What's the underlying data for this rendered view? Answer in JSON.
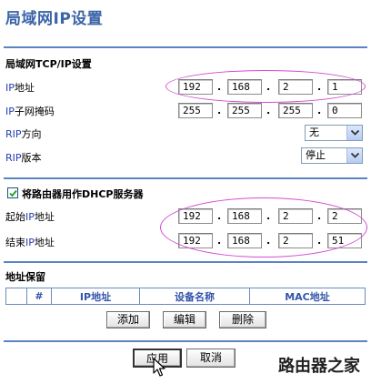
{
  "page": {
    "title": "局域网IP设置"
  },
  "lan_section": {
    "heading": "局域网TCP/IP设置",
    "ip_label_prefix": "IP",
    "ip_label_suffix": "地址",
    "ip": [
      "192",
      "168",
      "2",
      "1"
    ],
    "mask_label_prefix": "IP",
    "mask_label_suffix": "子网掩码",
    "mask": [
      "255",
      "255",
      "255",
      "0"
    ],
    "rip_dir_label_prefix": "RIP",
    "rip_dir_label_suffix": "方向",
    "rip_dir_value": "无",
    "rip_ver_label_prefix": "RIP",
    "rip_ver_label_suffix": "版本",
    "rip_ver_value": "停止"
  },
  "dhcp_section": {
    "checkbox_label": "将路由器用作DHCP服务器",
    "checked": true,
    "start_label_prefix": "起始",
    "start_label_mid": "IP",
    "start_label_suffix": "地址",
    "start_ip": [
      "192",
      "168",
      "2",
      "2"
    ],
    "end_label_prefix": "结束",
    "end_label_mid": "IP",
    "end_label_suffix": "地址",
    "end_ip": [
      "192",
      "168",
      "2",
      "51"
    ]
  },
  "reserve_section": {
    "heading": "地址保留",
    "columns": [
      "#",
      "IP地址",
      "设备名称",
      "MAC地址"
    ],
    "add_label": "添加",
    "edit_label": "编辑",
    "delete_label": "删除"
  },
  "footer": {
    "apply_label": "应用",
    "cancel_label": "取消",
    "watermark": "路由器之家"
  },
  "colors": {
    "accent": "#5a84c4",
    "title": "#3a65a8",
    "annotation": "#d44dd4"
  }
}
